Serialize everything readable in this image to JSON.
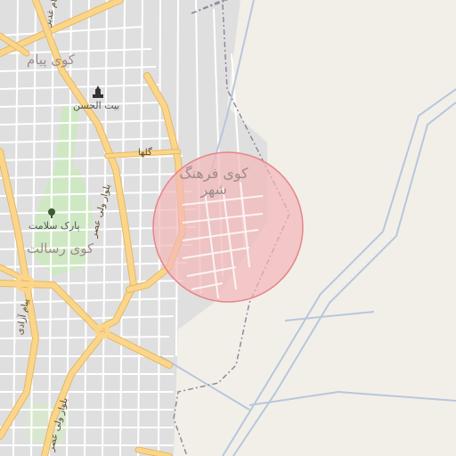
{
  "map": {
    "districts": {
      "kuy_payam": "کوی پیام",
      "kuy_farhangshahr": "کوی فرهنگ شهر",
      "kuy_resalat": "کوی رسالت"
    },
    "pois": {
      "beit_al_hassan": "بیت الحسن",
      "park_salamat": "پارک سلامت"
    },
    "streets": {
      "golha": "گلها",
      "boulevard_vali_asr_1": "بلوار ولی عصر",
      "boulevard_vali_asr_2": "بلوار ولی عصر",
      "payam_azadi": "پیام آزادی",
      "top_left_street": "پیام غدیر"
    },
    "highlight": {
      "fill": "#f3b6b8",
      "stroke": "#e5858a"
    },
    "colors": {
      "background": "#f2efe9",
      "residential": "#e0dfdf",
      "main_road": "#fbd68a",
      "road_casing": "#e2b866",
      "minor_road": "#ffffff",
      "park": "#cfe8c4",
      "railway_blue": "#b7c7dc",
      "boundary": "#8e8a9a"
    }
  }
}
